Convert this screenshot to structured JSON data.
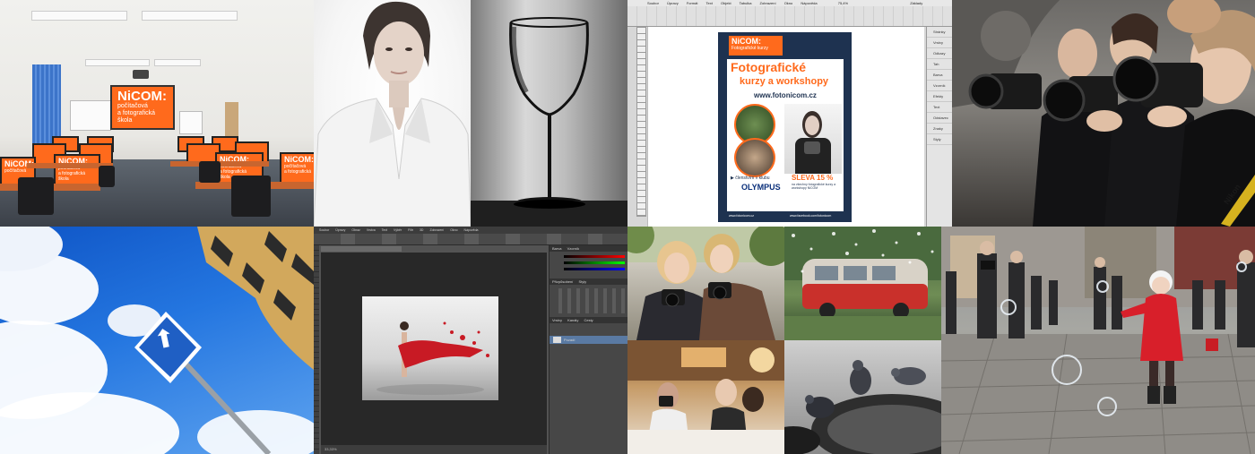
{
  "classroom": {
    "screen_title": "NiCOM:",
    "screen_lines": [
      "počítačová",
      "a fotografická",
      "škola"
    ],
    "monitor_title": "NiCOM:",
    "monitor_lines": [
      "počítačová",
      "a fotografická",
      "škola"
    ]
  },
  "indesign": {
    "menu": [
      "Soubor",
      "Úpravy",
      "Formát",
      "Text",
      "Objekt",
      "Tabulka",
      "Zobrazení",
      "Okno",
      "Nápověda"
    ],
    "zoom": "75,4%",
    "workspace": "Základy",
    "panels": [
      "Stránky",
      "Vrstvy",
      "Odkazy",
      "Tah",
      "Barva",
      "Vzorník",
      "Efekty",
      "Text",
      "Odstavec",
      "Znaky",
      "Styly"
    ],
    "poster": {
      "logo_title": "NiCOM:",
      "logo_subtitle": "Fotografické kurzy",
      "headline_1": "Fotografické",
      "headline_2": "kurzy a workshopy",
      "url": "www.fotonicom.cz",
      "member_text": "členstvím v klubu",
      "brand": "OLYMPUS",
      "discount": "SLEVA 15 %",
      "discount_sub": "na všechny fotografické kurzy a workshopy NiCOM",
      "footer_left": "www.fotonicom.cz",
      "footer_right": "www.facebook.com/fotonicom"
    }
  },
  "sign": {
    "arrow": "⬆"
  },
  "photoshop": {
    "menu": [
      "Soubor",
      "Úpravy",
      "Obraz",
      "Vrstva",
      "Text",
      "Výběr",
      "Filtr",
      "3D",
      "Zobrazení",
      "Okno",
      "Nápověda"
    ],
    "panels": [
      "Barva",
      "Vzorník",
      "Přizpůsobení",
      "Styly",
      "Vrstvy",
      "Kanály",
      "Cesty"
    ],
    "layer_name": "Pozadí",
    "zoom": "33,33%"
  },
  "camera_brand": "Nikon"
}
